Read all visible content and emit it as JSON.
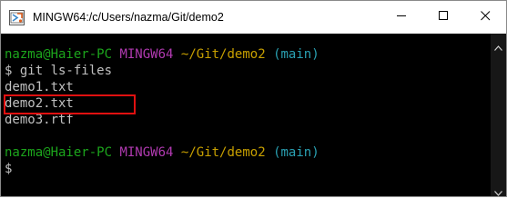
{
  "window": {
    "title": "MINGW64:/c/Users/nazma/Git/demo2",
    "app_icon": "mingw-terminal-icon",
    "controls": {
      "minimize_icon": "minimize-icon",
      "maximize_icon": "maximize-icon",
      "close_icon": "close-icon"
    }
  },
  "terminal": {
    "colors": {
      "background": "#000000",
      "user_host": "#1ca51c",
      "system": "#b03ab0",
      "path": "#c8a000",
      "branch": "#2aa1b3",
      "text": "#c0c0c0",
      "highlight_border": "#e01010"
    },
    "prompt1": {
      "user_host": "nazma@Haier-PC",
      "system": "MINGW64",
      "path": "~/Git/demo2",
      "branch": "(main)"
    },
    "command": "$ git ls-files",
    "output": [
      "demo1.txt",
      "demo2.txt",
      "demo3.rtf"
    ],
    "prompt2": {
      "user_host": "nazma@Haier-PC",
      "system": "MINGW64",
      "path": "~/Git/demo2",
      "branch": "(main)"
    },
    "cursor_prompt": "$"
  }
}
